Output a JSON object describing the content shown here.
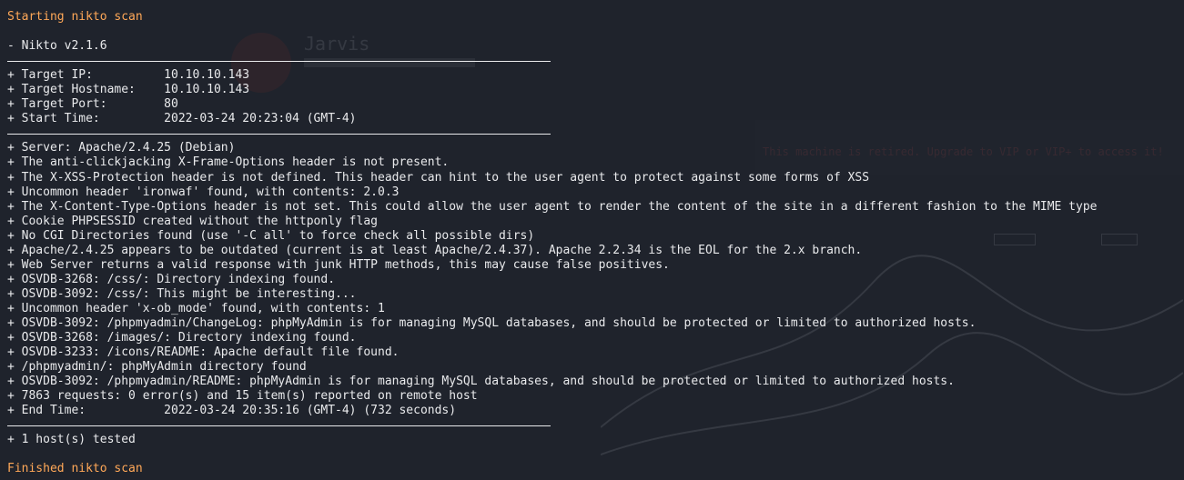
{
  "colors": {
    "background": "#1f232c",
    "text": "#e9eaec",
    "status": "#ffa858"
  },
  "status_start": "Starting nikto scan",
  "version_line": "- Nikto v2.1.6",
  "target_lines": [
    "+ Target IP:          10.10.10.143",
    "+ Target Hostname:    10.10.10.143",
    "+ Target Port:        80",
    "+ Start Time:         2022-03-24 20:23:04 (GMT-4)"
  ],
  "findings": [
    "+ Server: Apache/2.4.25 (Debian)",
    "+ The anti-clickjacking X-Frame-Options header is not present.",
    "+ The X-XSS-Protection header is not defined. This header can hint to the user agent to protect against some forms of XSS",
    "+ Uncommon header 'ironwaf' found, with contents: 2.0.3",
    "+ The X-Content-Type-Options header is not set. This could allow the user agent to render the content of the site in a different fashion to the MIME type",
    "+ Cookie PHPSESSID created without the httponly flag",
    "+ No CGI Directories found (use '-C all' to force check all possible dirs)",
    "+ Apache/2.4.25 appears to be outdated (current is at least Apache/2.4.37). Apache 2.2.34 is the EOL for the 2.x branch.",
    "+ Web Server returns a valid response with junk HTTP methods, this may cause false positives.",
    "+ OSVDB-3268: /css/: Directory indexing found.",
    "+ OSVDB-3092: /css/: This might be interesting...",
    "+ Uncommon header 'x-ob_mode' found, with contents: 1",
    "+ OSVDB-3092: /phpmyadmin/ChangeLog: phpMyAdmin is for managing MySQL databases, and should be protected or limited to authorized hosts.",
    "+ OSVDB-3268: /images/: Directory indexing found.",
    "+ OSVDB-3233: /icons/README: Apache default file found.",
    "+ /phpmyadmin/: phpMyAdmin directory found",
    "+ OSVDB-3092: /phpmyadmin/README: phpMyAdmin is for managing MySQL databases, and should be protected or limited to authorized hosts.",
    "+ 7863 requests: 0 error(s) and 15 item(s) reported on remote host",
    "+ End Time:           2022-03-24 20:35:16 (GMT-4) (732 seconds)"
  ],
  "hosts_line": "+ 1 host(s) tested",
  "status_end": "Finished nikto scan",
  "background_ghost": {
    "machine_name": "Jarvis",
    "retired_notice": "This machine is retired. Upgrade to VIP or VIP+ to access it!"
  }
}
